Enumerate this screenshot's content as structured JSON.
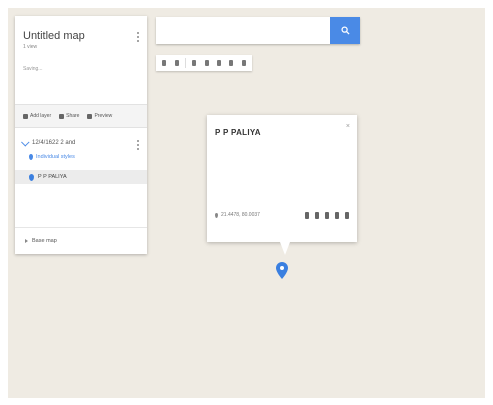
{
  "colors": {
    "map_background": "#efebe3",
    "accent_blue": "#4a8ae6",
    "panel_background": "#ffffff"
  },
  "panel": {
    "title": "Untitled map",
    "views": "1 view",
    "status": "Saving...",
    "actions": [
      {
        "icon": "add-layer-icon",
        "label": "Add layer"
      },
      {
        "icon": "share-icon",
        "label": "Share"
      },
      {
        "icon": "preview-icon",
        "label": "Preview"
      }
    ],
    "layer": {
      "name": "12/4/1622 2 and",
      "style_link": "Individual styles",
      "items": [
        {
          "icon": "map-pin-icon",
          "label": "P P PALIYA"
        }
      ]
    },
    "base_map_label": "Base map"
  },
  "search": {
    "value": "",
    "placeholder": "",
    "button_icon": "search-icon"
  },
  "toolbar": {
    "tools": [
      "undo-icon",
      "redo-icon",
      "hand-icon",
      "marker-icon",
      "line-icon",
      "directions-icon",
      "ruler-icon"
    ]
  },
  "info_window": {
    "title": "P P PALIYA",
    "coordinates": "21.4478, 80.0037",
    "tools": [
      "style-icon",
      "edit-icon",
      "camera-icon",
      "directions-icon",
      "delete-icon"
    ]
  }
}
